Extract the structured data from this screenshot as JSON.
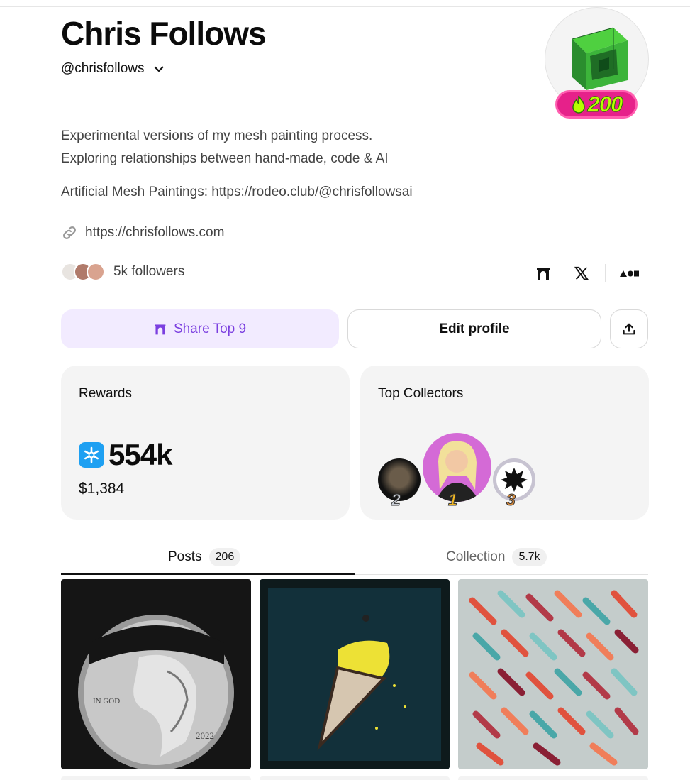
{
  "profile": {
    "name": "Chris Follows",
    "handle": "@chrisfollows",
    "level": "200",
    "bio_line1": "Experimental versions of my mesh painting process.",
    "bio_line2": "Exploring relationships between hand-made, code & AI",
    "bio_line3": "Artificial Mesh Paintings: https://rodeo.club/@chrisfollowsai",
    "website": "https://chrisfollows.com",
    "followers": "5k followers"
  },
  "social_icons": [
    "arch-icon",
    "x-logo-icon",
    "aeon-icon"
  ],
  "actions": {
    "share_label": "Share Top 9",
    "edit_label": "Edit profile"
  },
  "rewards": {
    "title": "Rewards",
    "amount": "554k",
    "usd": "$1,384"
  },
  "collectors": {
    "title": "Top Collectors",
    "ranks": [
      "2",
      "1",
      "3"
    ]
  },
  "tabs": {
    "posts_label": "Posts",
    "posts_count": "206",
    "collection_label": "Collection",
    "collection_count": "5.7k"
  },
  "colors": {
    "accent": "#7b3fe0",
    "share_bg": "#f2ebff",
    "card_bg": "#f4f4f4",
    "badge_pink": "#e6218a",
    "badge_green": "#b6ff00"
  }
}
